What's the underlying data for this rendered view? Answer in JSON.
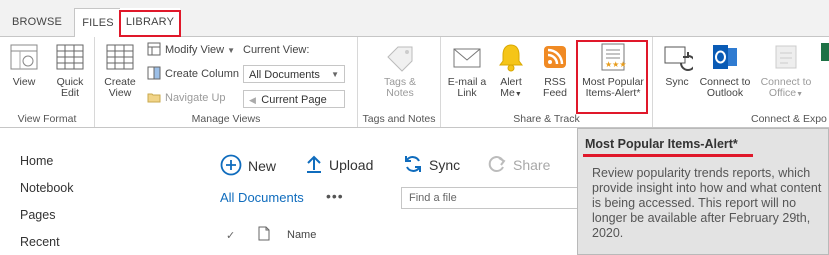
{
  "tabs": {
    "browse": "BROWSE",
    "files": "FILES",
    "library": "LIBRARY"
  },
  "ribbon": {
    "view_format": {
      "view": "View",
      "quick_edit": [
        "Quick",
        "Edit"
      ],
      "label": "View Format"
    },
    "manage_views": {
      "create_view": [
        "Create",
        "View"
      ],
      "modify_view": "Modify View",
      "create_column": "Create Column",
      "navigate_up": "Navigate Up",
      "current_view_label": "Current View:",
      "current_view_value": "All Documents",
      "current_page": "Current Page",
      "label": "Manage Views"
    },
    "tags_notes": {
      "button": [
        "Tags &",
        "Notes"
      ],
      "label": "Tags and Notes"
    },
    "share_track": {
      "email_link": [
        "E-mail a",
        "Link"
      ],
      "alert_me": [
        "Alert",
        "Me"
      ],
      "rss_feed": [
        "RSS",
        "Feed"
      ],
      "most_popular": [
        "Most Popular",
        "Items-Alert*"
      ],
      "label": "Share & Track"
    },
    "connect_export": {
      "sync": "Sync",
      "connect_outlook": [
        "Connect to",
        "Outlook"
      ],
      "connect_office": [
        "Connect to",
        "Office"
      ],
      "label": "Connect & Expo"
    }
  },
  "nav": {
    "items": [
      "Home",
      "Notebook",
      "Pages",
      "Recent"
    ]
  },
  "commands": {
    "new": "New",
    "upload": "Upload",
    "sync": "Sync",
    "share": "Share"
  },
  "view": {
    "name": "All Documents",
    "more": "•••",
    "find_placeholder": "Find a file"
  },
  "columns": {
    "name": "Name"
  },
  "tooltip": {
    "title": "Most Popular Items-Alert*",
    "body": "Review popularity trends reports, which provide insight into how and what content is being accessed. This report will no longer be available after February 29th, 2020."
  },
  "colors": {
    "highlight": "#e0182a",
    "link": "#0f6cbd",
    "tooltip_bg": "#e3e3e3"
  }
}
